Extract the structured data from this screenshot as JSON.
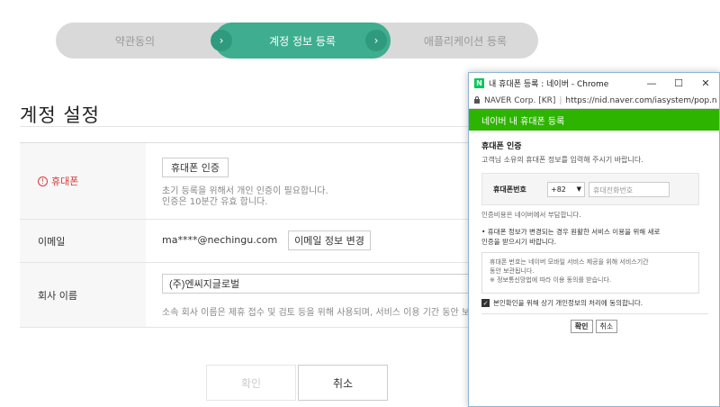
{
  "steps": [
    {
      "label": "약관동의"
    },
    {
      "label": "계정 정보 등록"
    },
    {
      "label": "애플리케이션 등록"
    }
  ],
  "step_arrow": "›",
  "page_title": "계정 설정",
  "form": {
    "phone": {
      "label": "휴대폰",
      "button": "휴대폰 인증",
      "hint_line1": "초기 등록을 위해서 개인 인증이 필요합니다.",
      "hint_line2": "인증은 10분간 유효 합니다."
    },
    "email": {
      "label": "이메일",
      "value": "ma****@nechingu.com",
      "button": "이메일 정보 변경"
    },
    "company": {
      "label": "회사 이름",
      "value": "(주)엔씨지글로벌",
      "hint": "소속 회사 이름은 제휴 접수 및 검토 등을 위해 사용되며, 서비스 이용 기간 동안 보관됩니다."
    }
  },
  "actions": {
    "confirm": "확인",
    "cancel": "취소"
  },
  "popup": {
    "window_title": "내 휴대폰 등록 : 네이버 - Chrome",
    "logo_letter": "N",
    "controls": {
      "minimize": "—",
      "maximize": "☐",
      "close": "✕"
    },
    "address_org": "NAVER Corp. [KR]",
    "address_url": "https://nid.naver.com/iasystem/pop.n",
    "header": "네이버 내 휴대폰 등록",
    "section_title": "휴대폰 인증",
    "section_desc": "고객님 소유의 휴대폰 정보를 입력해 주시기 바랍니다.",
    "phone_label": "휴대폰번호",
    "country_code": "+82",
    "phone_placeholder": "휴대전화번호",
    "cost_note": "인증비용은 네이버에서 부담합니다.",
    "change_note_line1": "• 휴대폰 정보가 변경되는 경우 원활한 서비스 이용을 위해 새로",
    "change_note_line2": "  인증을 받으시기 바랍니다.",
    "terms_line1": "휴대폰 번호는 네이버 모바일 서비스 제공을 위해 서비스기간",
    "terms_line2": "동안 보관됩니다.",
    "terms_line3": "※ 정보통신망법에 따라 이용 동의를 받습니다.",
    "agree_text": "본인확인을 위해 상기 개인정보의 처리에 동의합니다.",
    "agree_checked": true,
    "btn_ok": "확인",
    "btn_cancel": "취소"
  },
  "colors": {
    "step_active": "#3fad8f",
    "naver_green": "#2db400",
    "warning_red": "#d93b3b"
  }
}
